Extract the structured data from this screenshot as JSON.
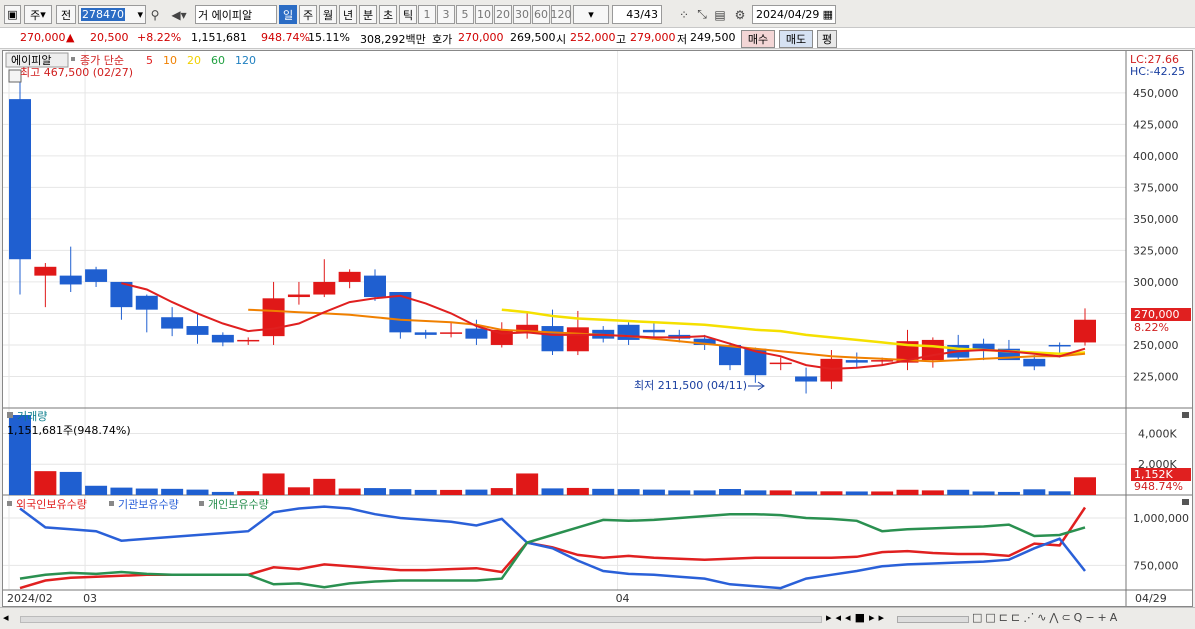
{
  "toolbar": {
    "market": "주",
    "prev_label": "전",
    "code": "278470",
    "name": "에이피알",
    "periods": [
      "일",
      "주",
      "월",
      "년",
      "분",
      "초",
      "틱"
    ],
    "active_period": "일",
    "intervals": [
      "1",
      "3",
      "5",
      "10",
      "20",
      "30",
      "60",
      "120"
    ],
    "prefix_label": "거",
    "count": "43",
    "count_total": "/43",
    "date": "2024/04/29"
  },
  "quote": {
    "price": "270,000",
    "arrow": "▲",
    "change": "20,500",
    "change_pct": "+8.22%",
    "volume": "1,151,681",
    "volume_ratio": "948.74%",
    "turnover": "15.11%",
    "trade_value": "308,292백만",
    "bid_label": "호가",
    "bid1": "270,000",
    "bid2": "269,500",
    "open_label": "시",
    "open": "252,000",
    "high_label": "고",
    "high": "279,000",
    "low_label": "저",
    "low": "249,500",
    "buy_label": "매수",
    "sell_label": "매도",
    "eval_label": "평"
  },
  "price_panel": {
    "stock_tag": "에이피알",
    "indicator_label": "종가 단순",
    "ma_periods": [
      "5",
      "10",
      "20",
      "60",
      "120"
    ],
    "ma_colors": [
      "#e02020",
      "#f08000",
      "#f0d000",
      "#20a040",
      "#2080c0"
    ],
    "max_label": "최고 467,500 (02/27)",
    "min_label": "최저 211,500 (04/11)",
    "lc": "LC:27.66",
    "hc": "HC:-42.25",
    "current_tag": "270,000",
    "current_pct": "8.22%"
  },
  "volume_panel": {
    "title": "거래량",
    "current": "1,151,681주(948.74%)",
    "current_tag": "1,152K",
    "current_pct": "948.74%"
  },
  "holding_panel": {
    "legend": [
      "외국인보유수량",
      "기관보유수량",
      "개인보유수량"
    ],
    "colors": [
      "#e02020",
      "#2a60d8",
      "#2a9050"
    ]
  },
  "x_axis": {
    "labels": [
      "2024/02",
      "03",
      "04"
    ],
    "last": "04/29"
  },
  "chart_data": [
    {
      "type": "candlestick",
      "title": "에이피알",
      "dates": [
        "02/27",
        "02/28",
        "02/29",
        "03/04",
        "03/05",
        "03/06",
        "03/07",
        "03/08",
        "03/11",
        "03/12",
        "03/13",
        "03/14",
        "03/15",
        "03/18",
        "03/19",
        "03/20",
        "03/21",
        "03/22",
        "03/25",
        "03/26",
        "03/27",
        "03/28",
        "03/29",
        "04/01",
        "04/02",
        "04/03",
        "04/04",
        "04/05",
        "04/08",
        "04/09",
        "04/11",
        "04/12",
        "04/15",
        "04/16",
        "04/17",
        "04/18",
        "04/19",
        "04/22",
        "04/23",
        "04/24",
        "04/25",
        "04/26",
        "04/29"
      ],
      "open": [
        445000,
        305000,
        305000,
        310000,
        300000,
        289000,
        272000,
        265000,
        258000,
        253000,
        257000,
        288000,
        290000,
        300000,
        305000,
        292000,
        260000,
        260000,
        263000,
        250000,
        260000,
        265000,
        245000,
        262000,
        266000,
        262000,
        258000,
        255000,
        250000,
        247000,
        235000,
        225000,
        221000,
        238000,
        238000,
        236000,
        238000,
        250000,
        251000,
        247000,
        239000,
        250000,
        252000
      ],
      "close": [
        318000,
        312000,
        298000,
        300000,
        280000,
        278000,
        263000,
        258000,
        252000,
        254000,
        287000,
        290000,
        300000,
        308000,
        288000,
        260000,
        258000,
        260000,
        255000,
        262000,
        266000,
        245000,
        264000,
        255000,
        254000,
        260000,
        255000,
        250000,
        234000,
        226000,
        236000,
        221000,
        239000,
        236000,
        238000,
        253000,
        254000,
        240000,
        246000,
        238000,
        233000,
        249000,
        270000
      ],
      "high": [
        467500,
        315000,
        328000,
        312000,
        300000,
        290000,
        280000,
        275000,
        260000,
        256000,
        300000,
        300000,
        318000,
        310000,
        310000,
        292000,
        262000,
        268000,
        270000,
        268000,
        276000,
        278000,
        277000,
        265000,
        268000,
        268000,
        262000,
        258000,
        252000,
        248000,
        240000,
        232000,
        246000,
        244000,
        240000,
        262000,
        256000,
        258000,
        255000,
        254000,
        242000,
        252000,
        279000
      ],
      "low": [
        290000,
        280000,
        292000,
        296000,
        270000,
        260000,
        257000,
        251000,
        249000,
        250000,
        250000,
        282000,
        288000,
        295000,
        285000,
        255000,
        255000,
        256000,
        250000,
        248000,
        255000,
        242000,
        242000,
        252000,
        250000,
        255000,
        252000,
        246000,
        230000,
        220000,
        230000,
        211500,
        215000,
        232000,
        234000,
        230000,
        232000,
        238000,
        238000,
        240000,
        230000,
        240000,
        249500
      ],
      "ma": {
        "5": [
          null,
          null,
          null,
          null,
          299000,
          294000,
          284000,
          275000,
          267000,
          261000,
          263000,
          267000,
          276000,
          284000,
          287000,
          289000,
          283000,
          275000,
          265000,
          259000,
          260000,
          258000,
          258000,
          258000,
          257000,
          256000,
          256000,
          257000,
          251000,
          245000,
          241000,
          234000,
          231000,
          232000,
          234000,
          238000,
          242000,
          245000,
          246000,
          245000,
          243000,
          241000,
          247000
        ],
        "20": [
          null,
          null,
          null,
          null,
          null,
          null,
          null,
          null,
          null,
          null,
          null,
          null,
          null,
          null,
          null,
          null,
          null,
          null,
          null,
          278000,
          276000,
          273000,
          271000,
          270000,
          269000,
          268000,
          267000,
          266000,
          264000,
          262000,
          261000,
          258000,
          256000,
          254000,
          252000,
          250000,
          249000,
          247000,
          246000,
          245000,
          244000,
          243000,
          244000
        ],
        "10": [
          null,
          null,
          null,
          null,
          null,
          null,
          null,
          null,
          null,
          278000,
          277000,
          276000,
          275000,
          274000,
          272000,
          270000,
          269000,
          268000,
          266000,
          262000,
          261000,
          260000,
          259000,
          258000,
          257000,
          255000,
          253000,
          251000,
          249000,
          247000,
          245000,
          243000,
          241000,
          240000,
          239000,
          238000,
          237000,
          238000,
          239000,
          240000,
          241000,
          241000,
          243000
        ]
      },
      "ylim": [
        200000,
        480000
      ],
      "yticks": [
        "450,000",
        "425,000",
        "400,000",
        "375,000",
        "350,000",
        "325,000",
        "300,000",
        "275,000",
        "250,000",
        "225,000"
      ]
    },
    {
      "type": "bar",
      "title": "거래량",
      "values": [
        5200,
        1550,
        1500,
        600,
        480,
        420,
        400,
        350,
        200,
        250,
        1400,
        500,
        1050,
        420,
        450,
        380,
        330,
        330,
        350,
        450,
        1400,
        430,
        460,
        400,
        380,
        350,
        300,
        300,
        390,
        300,
        300,
        230,
        240,
        230,
        230,
        340,
        300,
        340,
        230,
        200,
        370,
        240,
        1152
      ],
      "ylim": [
        0,
        5200
      ],
      "yticks": [
        "4,000K",
        "2,000K"
      ]
    },
    {
      "type": "line",
      "title": "보유수량",
      "series": [
        {
          "name": "외국인보유수량",
          "values": [
            630000,
            670000,
            685000,
            690000,
            695000,
            700000,
            700000,
            700000,
            700000,
            700000,
            740000,
            730000,
            755000,
            745000,
            735000,
            725000,
            725000,
            730000,
            735000,
            715000,
            870000,
            845000,
            805000,
            790000,
            800000,
            790000,
            785000,
            780000,
            785000,
            790000,
            790000,
            790000,
            790000,
            795000,
            820000,
            825000,
            815000,
            810000,
            810000,
            800000,
            865000,
            855000,
            1055000
          ]
        },
        {
          "name": "기관보유수량",
          "values": [
            1050000,
            950000,
            940000,
            930000,
            880000,
            890000,
            900000,
            910000,
            920000,
            930000,
            1030000,
            1050000,
            1060000,
            1050000,
            1020000,
            1000000,
            990000,
            980000,
            960000,
            995000,
            870000,
            840000,
            775000,
            720000,
            705000,
            700000,
            690000,
            680000,
            650000,
            640000,
            630000,
            680000,
            700000,
            720000,
            745000,
            755000,
            760000,
            765000,
            770000,
            780000,
            840000,
            890000,
            720000
          ]
        },
        {
          "name": "개인보유수량",
          "values": [
            680000,
            700000,
            710000,
            705000,
            715000,
            705000,
            700000,
            700000,
            700000,
            700000,
            650000,
            655000,
            635000,
            655000,
            665000,
            670000,
            670000,
            670000,
            670000,
            680000,
            870000,
            910000,
            950000,
            990000,
            985000,
            990000,
            1000000,
            1010000,
            1020000,
            1020000,
            1015000,
            1000000,
            995000,
            985000,
            930000,
            940000,
            945000,
            950000,
            955000,
            965000,
            905000,
            910000,
            950000
          ]
        }
      ],
      "ylim": [
        620000,
        1100000
      ],
      "yticks": [
        "1,000,000",
        "750,000"
      ]
    }
  ]
}
